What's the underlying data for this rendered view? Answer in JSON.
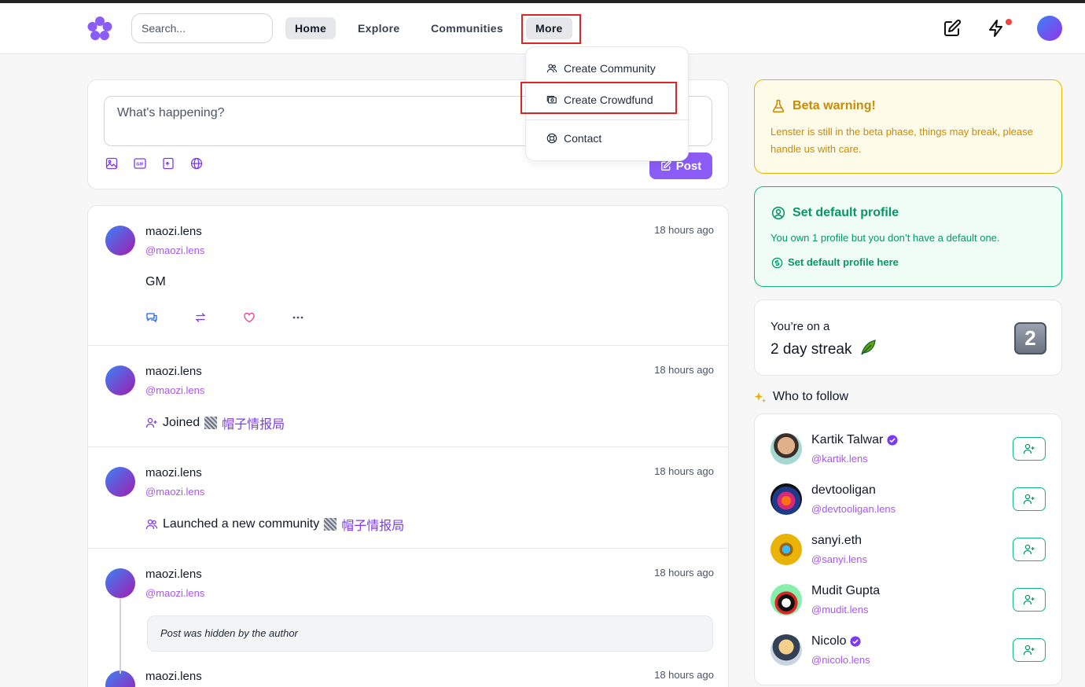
{
  "header": {
    "search_placeholder": "Search...",
    "nav": {
      "home": "Home",
      "explore": "Explore",
      "communities": "Communities",
      "more": "More"
    }
  },
  "dropdown": {
    "items": [
      {
        "label": "Create Community",
        "icon": "users-icon"
      },
      {
        "label": "Create Crowdfund",
        "icon": "cash-icon"
      },
      {
        "label": "Contact",
        "icon": "support-icon"
      }
    ]
  },
  "composer": {
    "placeholder": "What's happening?",
    "post_label": "Post"
  },
  "feed": {
    "posts": [
      {
        "name": "maozi.lens",
        "handle": "@maozi.lens",
        "time": "18 hours ago",
        "text": "GM"
      },
      {
        "name": "maozi.lens",
        "handle": "@maozi.lens",
        "time": "18 hours ago",
        "action": "Joined",
        "community": "帽子情报局"
      },
      {
        "name": "maozi.lens",
        "handle": "@maozi.lens",
        "time": "18 hours ago",
        "action": "Launched a new community",
        "community": "帽子情报局"
      },
      {
        "name": "maozi.lens",
        "handle": "@maozi.lens",
        "time": "18 hours ago",
        "hidden_text": "Post was hidden by the author"
      },
      {
        "name": "maozi.lens",
        "time": "18 hours ago"
      }
    ]
  },
  "beta": {
    "title": "Beta warning!",
    "text": "Lenster is still in the beta phase, things may break, please handle us with care."
  },
  "default_profile": {
    "title": "Set default profile",
    "text": "You own 1 profile but you don’t have a default one.",
    "link": "Set default profile here"
  },
  "streak": {
    "line1": "You’re on a",
    "line2": "2 day streak",
    "badge": "2"
  },
  "who_to_follow": {
    "title": "Who to follow",
    "users": [
      {
        "name": "Kartik Talwar",
        "handle": "@kartik.lens",
        "verified": true
      },
      {
        "name": "devtooligan",
        "handle": "@devtooligan.lens",
        "verified": false
      },
      {
        "name": "sanyi.eth",
        "handle": "@sanyi.lens",
        "verified": false
      },
      {
        "name": "Mudit Gupta",
        "handle": "@mudit.lens",
        "verified": false
      },
      {
        "name": "Nicolo",
        "handle": "@nicolo.lens",
        "verified": true
      }
    ]
  },
  "colors": {
    "brand": "#8b5cf6",
    "handle": "#a855f7",
    "warning": "#ca8a04",
    "success": "#059669",
    "highlight": "#dc2626"
  }
}
